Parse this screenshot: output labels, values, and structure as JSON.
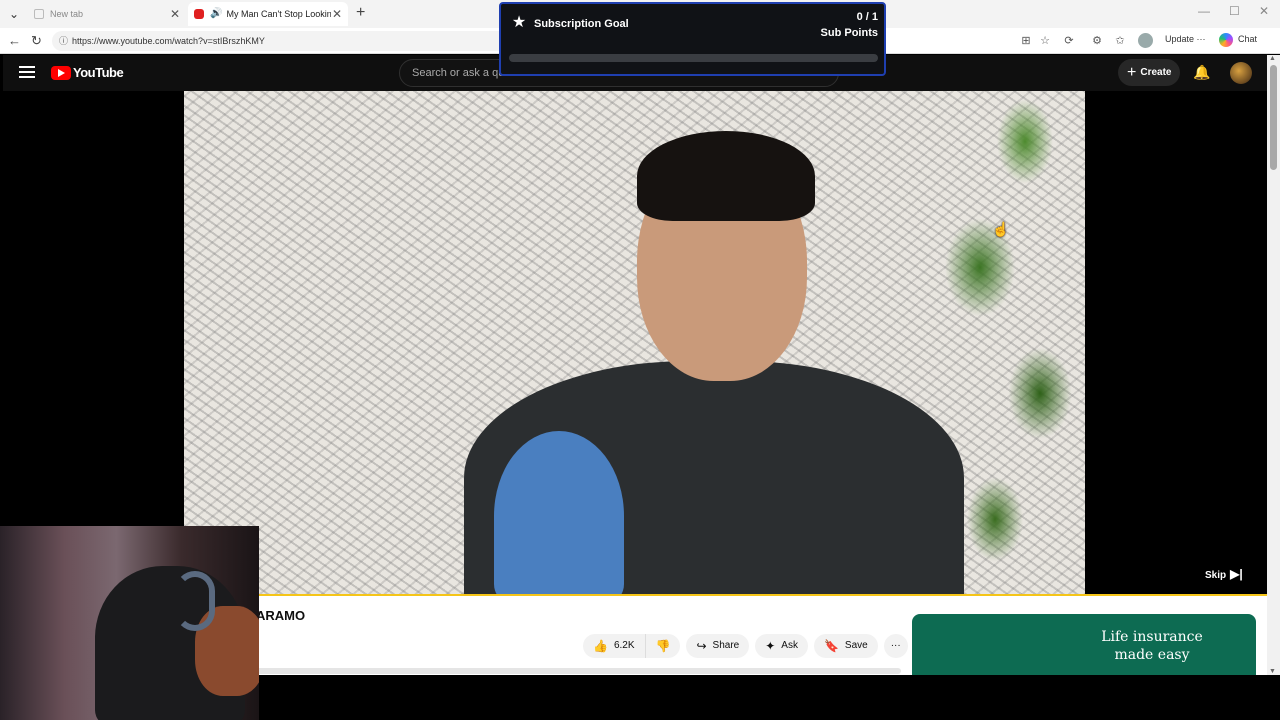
{
  "browser": {
    "tabs": [
      {
        "title": "New tab",
        "active": false
      },
      {
        "title": "My Man Can't Stop Looking a",
        "active": true
      }
    ],
    "url": "https://www.youtube.com/watch?v=stIBrszhKMY",
    "update_label": "Update",
    "chat_label": "Chat",
    "window_controls": [
      "minimize-icon",
      "maximize-icon",
      "close-icon"
    ]
  },
  "youtube": {
    "logo_text": "YouTube",
    "search_placeholder": "Search or ask a qu",
    "create_label": "Create",
    "skip_label": "Skip",
    "video_title_partial": "ARAMO",
    "actions": {
      "like_count": "6.2K",
      "share_label": "Share",
      "ask_label": "Ask",
      "save_label": "Save"
    },
    "ad": {
      "text": "Life insurance made easy",
      "color": "#0d6b52"
    }
  },
  "overlay_goal": {
    "title": "Subscription Goal",
    "count": "0 / 1",
    "unit": "Sub Points",
    "progress_fraction": 0,
    "border_color": "#1f3fb0"
  }
}
